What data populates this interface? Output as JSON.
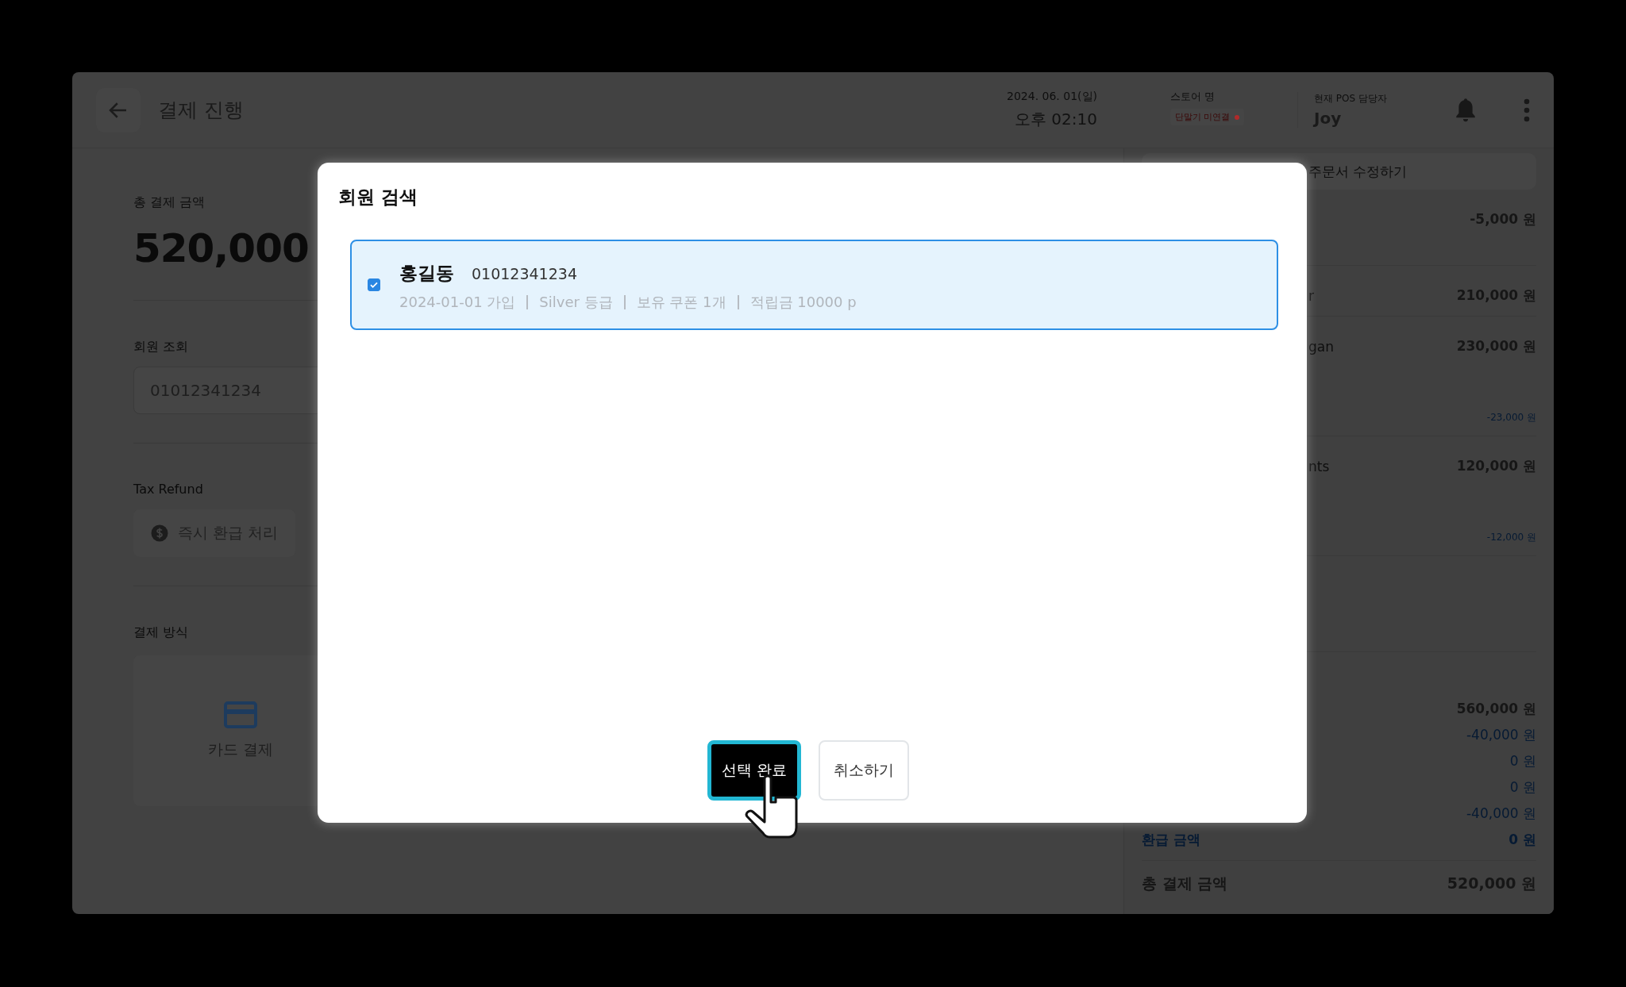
{
  "header": {
    "title": "결제 진행",
    "date": "2024. 06. 01(일)",
    "time": "오후 02:10",
    "store": {
      "label": "스토어 명",
      "status": "단말기 미연결"
    },
    "staff": {
      "label": "현재 POS 담당자",
      "name": "Joy"
    }
  },
  "payment": {
    "total_label": "총 결제 금액",
    "total": "520,000",
    "member_lookup": {
      "label": "회원 조회",
      "value": "01012341234"
    },
    "tax_refund": {
      "label": "Tax Refund",
      "button": "즉시 환급 처리"
    },
    "method": {
      "label": "결제 방식",
      "options": [
        {
          "label": "카드 결제"
        }
      ]
    }
  },
  "order": {
    "edit_button": "주문서 수정하기",
    "items": [
      {
        "amount": "-5,000 원"
      },
      {
        "label": "r",
        "amount": "210,000 원"
      },
      {
        "label": "gan",
        "amount": "230,000 원",
        "discount": "-23,000 원"
      },
      {
        "label": "nts",
        "amount": "120,000 원",
        "discount": "-12,000 원"
      }
    ],
    "summary": [
      {
        "kind": "subtotal",
        "amount": "560,000 원"
      },
      {
        "kind": "adjust",
        "amount": "-40,000 원"
      },
      {
        "kind": "adjust",
        "amount": "0 원"
      },
      {
        "kind": "adjust",
        "amount": "0 원"
      },
      {
        "kind": "adjust",
        "amount": "-40,000 원"
      },
      {
        "kind": "refund",
        "label": "환급 금액",
        "amount": "0 원"
      }
    ],
    "total": {
      "label": "총 결제 금액",
      "amount": "520,000 원"
    }
  },
  "modal": {
    "title": "회원 검색",
    "members": [
      {
        "name": "홍길동",
        "phone": "01012341234",
        "details": [
          "2024-01-01 가입",
          "Silver 등급",
          "보유 쿠폰 1개",
          "적립금 10000 p"
        ],
        "checked": true
      }
    ],
    "buttons": [
      {
        "label": "선택 완료",
        "kind": "primary",
        "focused": true
      },
      {
        "label": "취소하기",
        "kind": "secondary",
        "focused": false
      }
    ]
  }
}
